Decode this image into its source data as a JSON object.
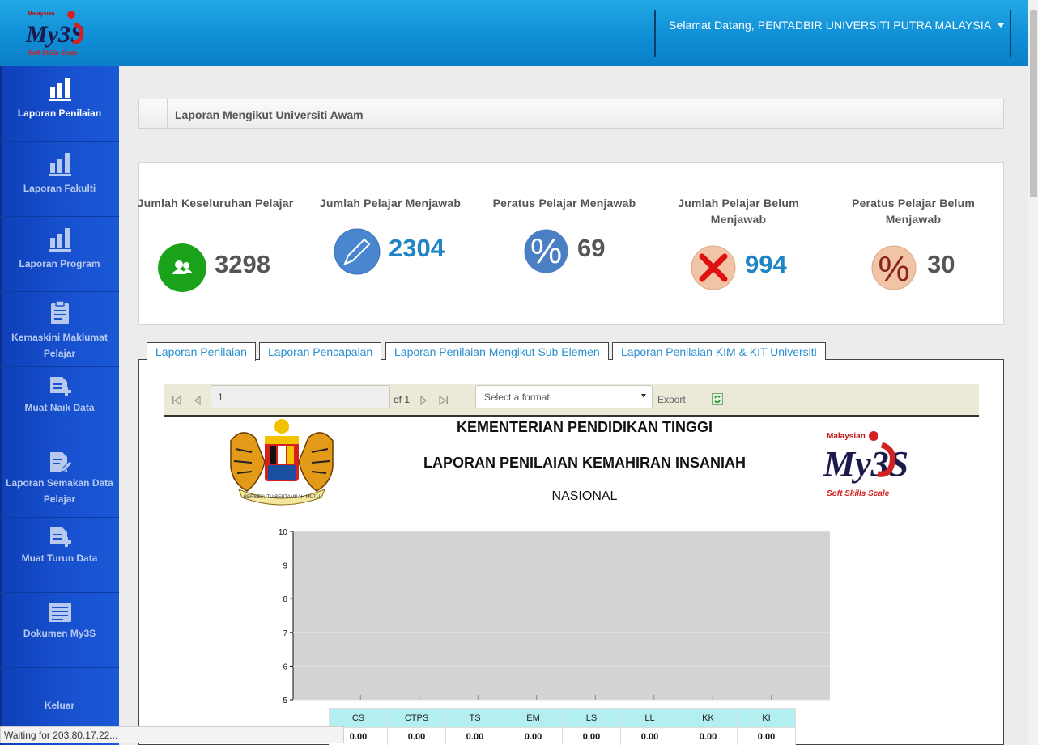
{
  "header": {
    "logo_text": "My3S",
    "welcome": "Selamat Datang, PENTADBIR UNIVERSITI PUTRA MALAYSIA"
  },
  "sidebar": {
    "items": [
      {
        "label": "Laporan Penilaian",
        "icon": "bar-chart-icon",
        "active": true
      },
      {
        "label": "Laporan Fakulti",
        "icon": "bar-chart-icon"
      },
      {
        "label": "Laporan Program",
        "icon": "bar-chart-icon"
      },
      {
        "label": "Kemaskini Maklumat Pelajar",
        "icon": "clipboard-icon"
      },
      {
        "label": "Muat Naik Data",
        "icon": "document-add-icon"
      },
      {
        "label": "Laporan Semakan Data Pelajar",
        "icon": "document-edit-icon"
      },
      {
        "label": "Muat Turun Data",
        "icon": "document-add-icon"
      },
      {
        "label": "Dokumen My3S",
        "icon": "list-icon"
      },
      {
        "label": "Keluar",
        "icon": ""
      }
    ]
  },
  "breadcrumb": {
    "title": "Laporan Mengikut Universiti Awam"
  },
  "stats": [
    {
      "title": "Jumlah Keseluruhan Pelajar",
      "value": "3298",
      "icon": "users-icon",
      "color": "#1aa31a"
    },
    {
      "title": "Jumlah Pelajar Menjawab",
      "value": "2304",
      "icon": "pencil-icon",
      "color": "#4a86d0"
    },
    {
      "title": "Peratus Pelajar Menjawab",
      "value": "69",
      "icon": "percent-icon",
      "color": "#4a7fc4"
    },
    {
      "title": "Jumlah Pelajar Belum Menjawab",
      "value": "994",
      "icon": "cross-icon",
      "color": "#f2c4a6"
    },
    {
      "title": "Peratus Pelajar Belum Menjawab",
      "value": "30",
      "icon": "percent-icon",
      "color": "#f2c4a6"
    }
  ],
  "tabs": [
    {
      "label": "Laporan Penilaian",
      "active": true
    },
    {
      "label": "Laporan Pencapaian"
    },
    {
      "label": "Laporan Penilaian Mengikut Sub Elemen"
    },
    {
      "label": "Laporan Penilaian KIM & KIT Universiti"
    }
  ],
  "report_toolbar": {
    "page_value": "1",
    "of_pages": "of 1",
    "format_placeholder": "Select a format",
    "export_label": "Export"
  },
  "report": {
    "heading1": "KEMENTERIAN PENDIDIKAN TINGGI",
    "heading2": "LAPORAN PENILAIAN KEMAHIRAN INSANIAH",
    "heading3": "NASIONAL",
    "crest_text": "BERSEKUTU BERTAMBAH MUTU",
    "logo_text_top": "Malaysian",
    "logo_text_mid": "My3S",
    "logo_text_bottom": "Soft Skills Scale"
  },
  "chart_data": {
    "type": "bar",
    "categories": [
      "CS",
      "CTPS",
      "TS",
      "EM",
      "LS",
      "LL",
      "KK",
      "KI"
    ],
    "values": [
      0.0,
      0.0,
      0.0,
      0.0,
      0.0,
      0.0,
      0.0,
      0.0
    ],
    "value_labels": [
      "0.00",
      "0.00",
      "0.00",
      "0.00",
      "0.00",
      "0.00",
      "0.00",
      "0.00"
    ],
    "yticks": [
      "10",
      "9",
      "8",
      "7",
      "6",
      "5"
    ],
    "ylim": [
      5,
      10
    ],
    "grid": true,
    "plot_bg": "#d3d3d3"
  },
  "status": {
    "text": "Waiting for 203.80.17.22..."
  }
}
